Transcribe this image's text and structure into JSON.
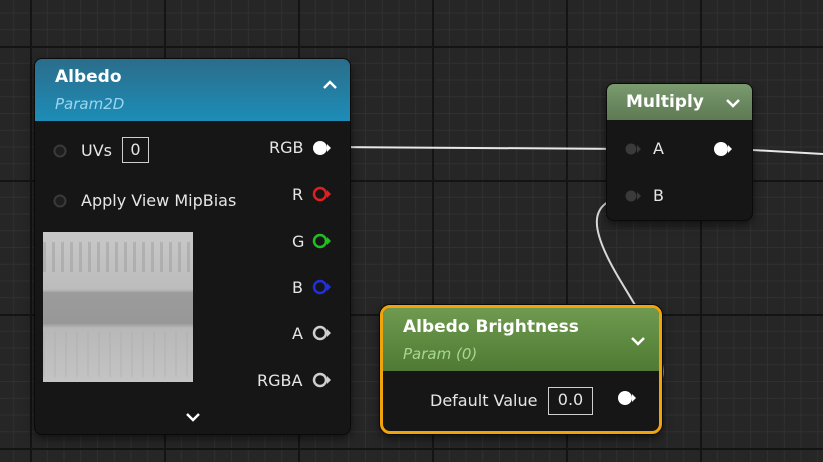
{
  "albedo_node": {
    "title": "Albedo",
    "subtitle": "Param2D",
    "inputs": [
      {
        "label": "UVs",
        "value": "0"
      },
      {
        "label": "Apply View MipBias"
      }
    ],
    "outputs": [
      {
        "label": "RGB",
        "color": "#ffffff"
      },
      {
        "label": "R",
        "color": "#e02020"
      },
      {
        "label": "G",
        "color": "#20c020"
      },
      {
        "label": "B",
        "color": "#2030e0"
      },
      {
        "label": "A",
        "color": "#cfcfcf"
      },
      {
        "label": "RGBA",
        "color": "#cfcfcf"
      }
    ],
    "header_color": "#1d8db8",
    "collapse_icon": "chevron-up-icon",
    "expand_icon": "chevron-down-icon"
  },
  "multiply_node": {
    "title": "Multiply",
    "inputs": [
      {
        "label": "A"
      },
      {
        "label": "B"
      }
    ],
    "header_color": "#6b8a5e",
    "menu_icon": "chevron-down-icon"
  },
  "brightness_node": {
    "title": "Albedo Brightness",
    "subtitle": "Param (0)",
    "default_value_label": "Default Value",
    "default_value": "0.0",
    "header_color": "#5e8a40",
    "selection_color": "#f0a30a",
    "menu_icon": "chevron-down-icon"
  }
}
